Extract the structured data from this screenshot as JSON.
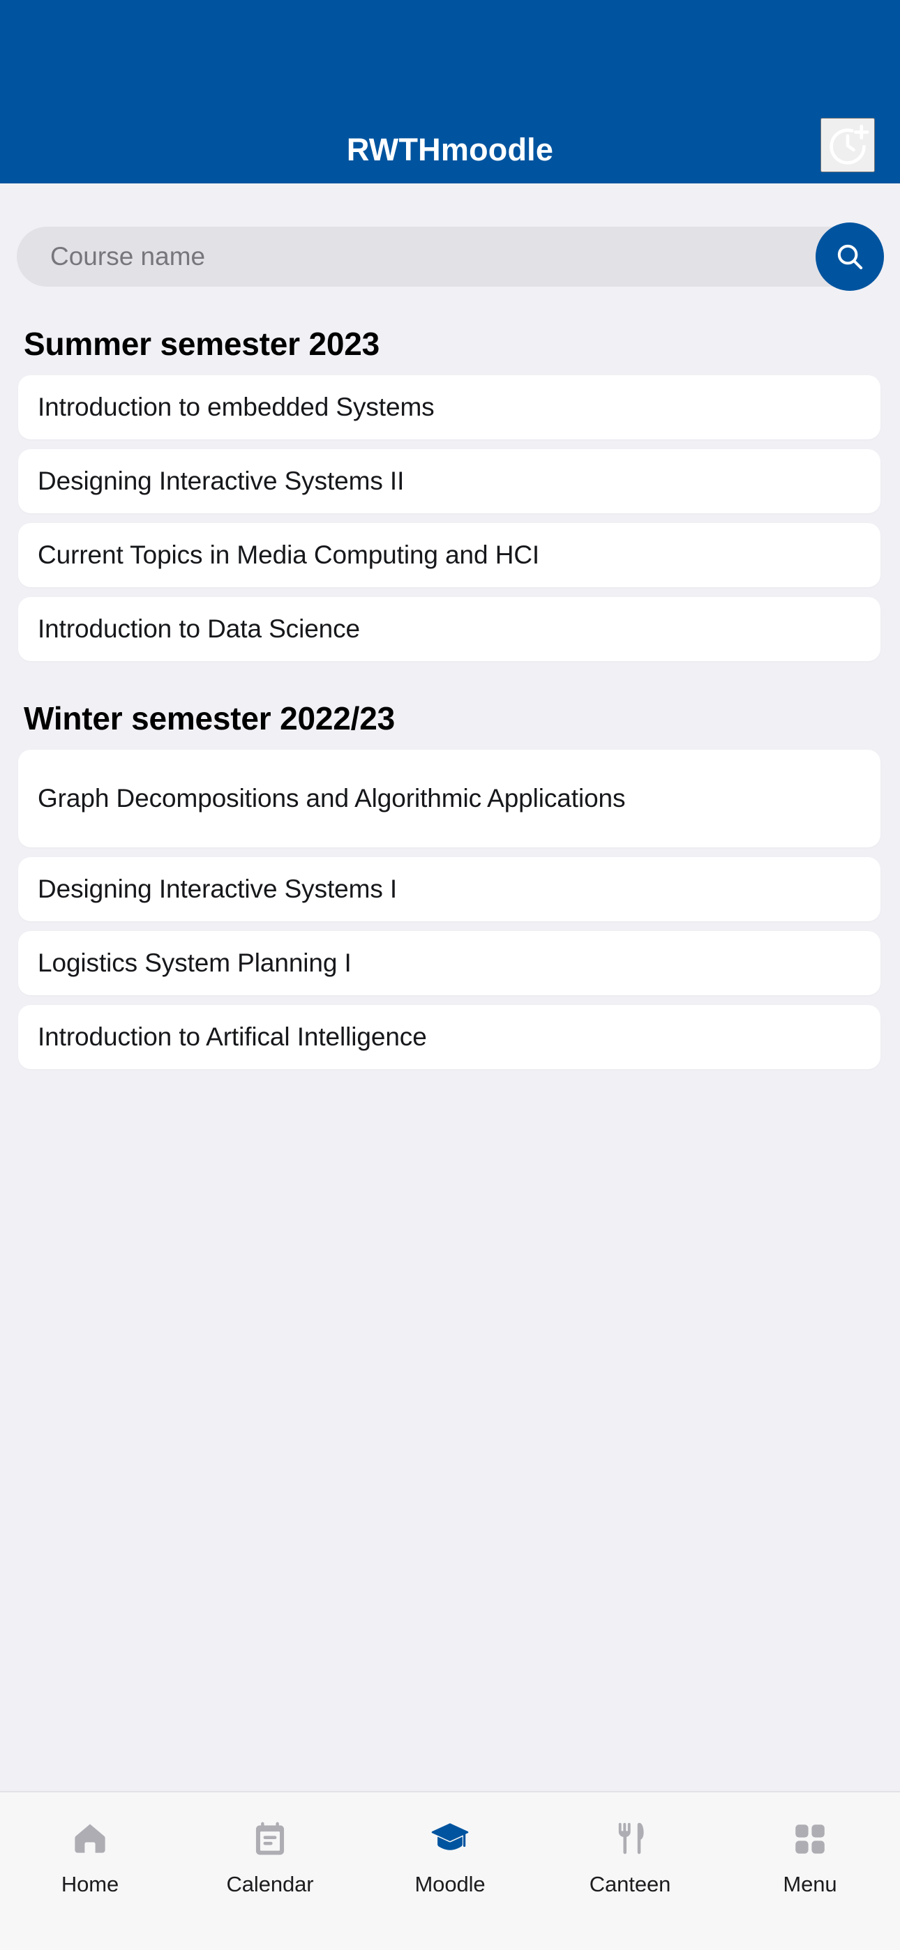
{
  "app": {
    "title": "RWTHmoodle",
    "header_action_icon": "clock-plus-icon",
    "colors": {
      "brand_blue": "#00549F",
      "page_background": "#F1F0F5",
      "card_background": "#FFFFFF",
      "search_background": "#E2E1E6",
      "tabbar_background": "#F7F7F8",
      "icon_inactive": "#AEADB3"
    }
  },
  "search": {
    "placeholder": "Course name",
    "value": "",
    "button_icon": "search-icon",
    "button_label": "Search"
  },
  "sections": [
    {
      "title": "Summer semester 2023",
      "courses": [
        "Introduction to embedded Systems",
        "Designing Interactive Systems II",
        "Current Topics in Media Computing and HCI",
        "Introduction to Data Science"
      ]
    },
    {
      "title": "Winter semester 2022/23",
      "courses": [
        "Graph Decompositions and Algorithmic Applications",
        "Designing Interactive Systems I",
        "Logistics System Planning I",
        "Introduction to Artifical Intelligence"
      ]
    }
  ],
  "tabbar": {
    "active_index": 2,
    "items": [
      {
        "label": "Home",
        "icon": "home-icon"
      },
      {
        "label": "Calendar",
        "icon": "calendar-icon"
      },
      {
        "label": "Moodle",
        "icon": "graduation-cap-icon"
      },
      {
        "label": "Canteen",
        "icon": "fork-knife-icon"
      },
      {
        "label": "Menu",
        "icon": "grid-menu-icon"
      }
    ]
  }
}
